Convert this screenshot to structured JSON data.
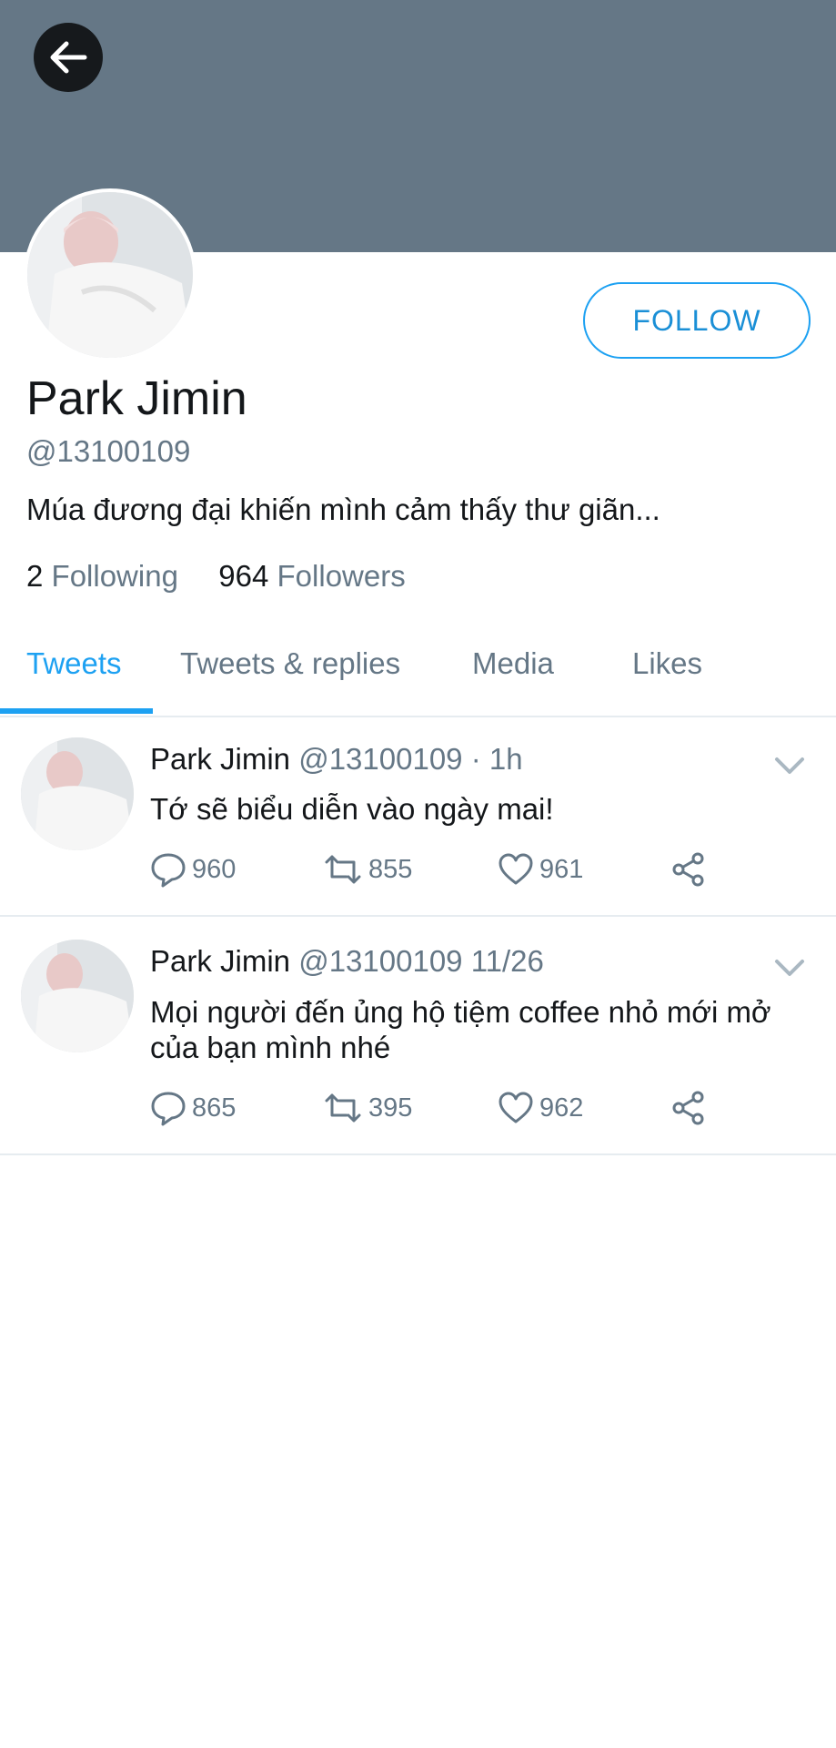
{
  "profile": {
    "name": "Park Jimin",
    "handle": "@13100109",
    "bio": "Múa đương đại khiến mình cảm thấy thư giãn...",
    "following_count": "2",
    "following_label": "Following",
    "followers_count": "964",
    "followers_label": "Followers",
    "follow_button": "FOLLOW"
  },
  "tabs": [
    {
      "label": "Tweets",
      "active": true
    },
    {
      "label": "Tweets & replies",
      "active": false
    },
    {
      "label": "Media",
      "active": false
    },
    {
      "label": "Likes",
      "active": false
    }
  ],
  "tweets": [
    {
      "author": "Park Jimin",
      "meta": "@13100109 · 1h",
      "text": "Tớ sẽ biểu diễn vào ngày mai!",
      "replies": "960",
      "retweets": "855",
      "likes": "961"
    },
    {
      "author": "Park Jimin",
      "meta": "@13100109 11/26",
      "text": "Mọi người đến ủng hộ tiệm coffee nhỏ mới mở của bạn mình nhé",
      "replies": "865",
      "retweets": "395",
      "likes": "962"
    }
  ],
  "colors": {
    "banner": "#657786",
    "accent": "#1da1f2",
    "muted": "#657786",
    "text": "#14171a"
  },
  "icons": [
    "back-arrow-icon",
    "chevron-down-icon",
    "reply-icon",
    "retweet-icon",
    "like-icon",
    "share-icon"
  ]
}
